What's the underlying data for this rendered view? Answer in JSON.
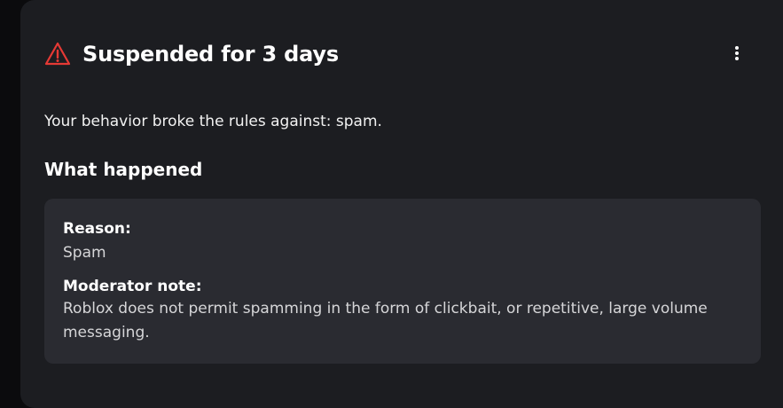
{
  "header": {
    "title": "Suspended for 3 days",
    "icon": "warning-triangle-icon",
    "menu_icon": "more-vertical-icon",
    "accent_color": "#e53935"
  },
  "intro_text": "Your behavior broke the rules against: spam.",
  "section_title": "What happened",
  "details": {
    "reason_label": "Reason:",
    "reason_value": "Spam",
    "note_label": "Moderator note:",
    "note_value": "Roblox does not permit spamming in the form of clickbait, or repetitive, large volume messaging."
  }
}
